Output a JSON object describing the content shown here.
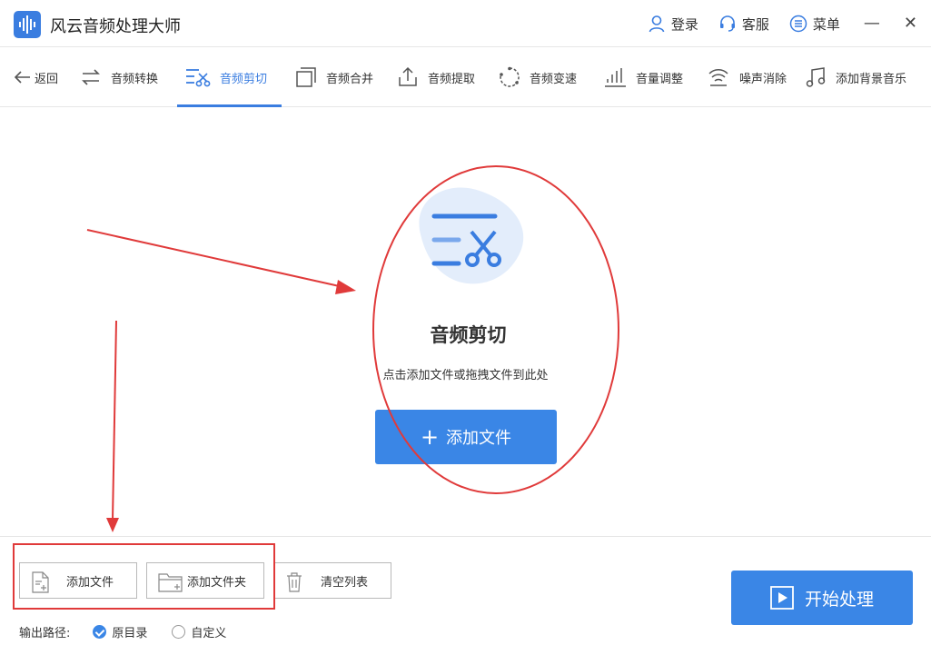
{
  "app": {
    "title": "风云音频处理大师"
  },
  "titlebar": {
    "login": "登录",
    "service": "客服",
    "menu": "菜单",
    "minimize": "—",
    "close": "✕"
  },
  "nav": {
    "back": "返回",
    "items": [
      {
        "label": "音频转换",
        "icon": "convert-icon"
      },
      {
        "label": "音频剪切",
        "icon": "cut-icon",
        "active": true
      },
      {
        "label": "音频合并",
        "icon": "merge-icon"
      },
      {
        "label": "音频提取",
        "icon": "extract-icon"
      },
      {
        "label": "音频变速",
        "icon": "speed-icon"
      },
      {
        "label": "音量调整",
        "icon": "volume-icon"
      },
      {
        "label": "噪声消除",
        "icon": "noise-icon"
      },
      {
        "label": "添加背景音乐",
        "icon": "music-icon"
      }
    ]
  },
  "main": {
    "title": "音频剪切",
    "subtitle": "点击添加文件或拖拽文件到此处",
    "add_file": "添加文件"
  },
  "bottom": {
    "add_file": "添加文件",
    "add_folder": "添加文件夹",
    "clear_list": "清空列表",
    "start": "开始处理",
    "output_label": "输出路径:",
    "opt_original": "原目录",
    "opt_custom": "自定义"
  },
  "colors": {
    "accent": "#3a86e6",
    "annotation": "#e03a3a"
  }
}
